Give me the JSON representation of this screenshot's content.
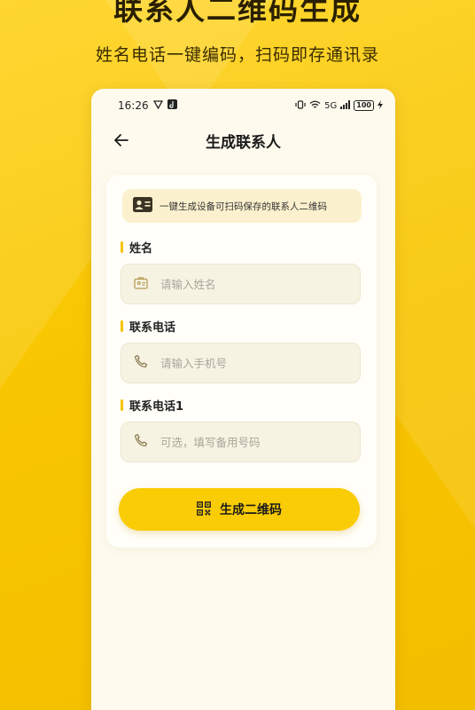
{
  "promo": {
    "title": "联系人二维码生成",
    "subtitle": "姓名电话一键编码，扫码即存通讯录"
  },
  "status_bar": {
    "time": "16:26",
    "network": "5G",
    "battery": "100"
  },
  "nav": {
    "title": "生成联系人"
  },
  "tip": {
    "text": "一键生成设备可扫码保存的联系人二维码"
  },
  "fields": [
    {
      "label": "姓名",
      "placeholder": "请输入姓名",
      "value": "",
      "icon": "id-card-icon"
    },
    {
      "label": "联系电话",
      "placeholder": "请输入手机号",
      "value": "",
      "icon": "phone-icon"
    },
    {
      "label": "联系电话1",
      "placeholder": "可选，填写备用号码",
      "value": "",
      "icon": "phone-icon"
    }
  ],
  "generate_button": {
    "label": "生成二维码",
    "icon": "qr-code-icon"
  },
  "colors": {
    "background": "#F7C300",
    "accent": "#FACC05",
    "card": "#FFFEF8"
  }
}
